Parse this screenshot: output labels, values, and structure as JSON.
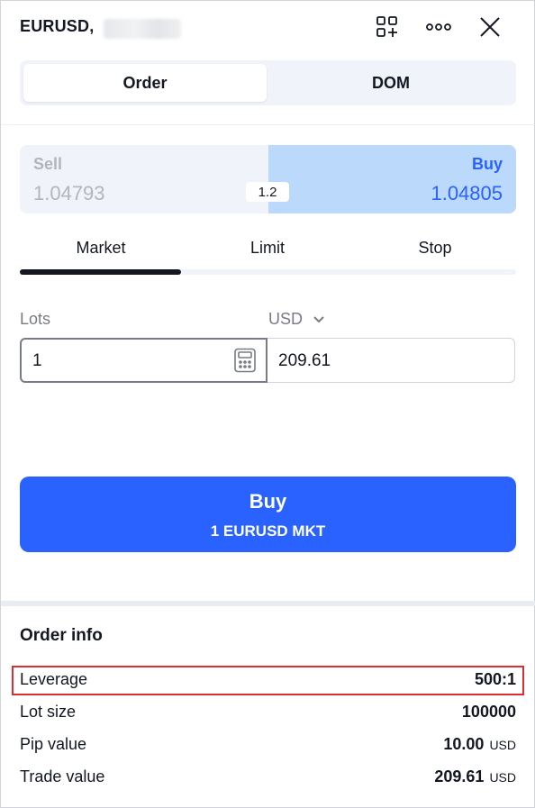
{
  "header": {
    "symbol": "EURUSD,",
    "icons": [
      "add-widget-icon",
      "more-icon",
      "close-icon"
    ]
  },
  "mode_tabs": [
    {
      "label": "Order",
      "active": true
    },
    {
      "label": "DOM",
      "active": false
    }
  ],
  "quote": {
    "sell_label": "Sell",
    "sell_price": "1.04793",
    "buy_label": "Buy",
    "buy_price": "1.04805",
    "spread": "1.2"
  },
  "order_types": [
    {
      "label": "Market",
      "active": true
    },
    {
      "label": "Limit",
      "active": false
    },
    {
      "label": "Stop",
      "active": false
    }
  ],
  "inputs": {
    "lots_label": "Lots",
    "lots_value": "1",
    "currency_label": "USD",
    "currency_value": "209.61"
  },
  "action": {
    "title": "Buy",
    "subtitle": "1 EURUSD MKT"
  },
  "order_info": {
    "title": "Order info",
    "rows": [
      {
        "key": "Leverage",
        "value": "500:1",
        "unit": ""
      },
      {
        "key": "Lot size",
        "value": "100000",
        "unit": ""
      },
      {
        "key": "Pip value",
        "value": "10.00",
        "unit": "USD"
      },
      {
        "key": "Trade value",
        "value": "209.61",
        "unit": "USD"
      }
    ]
  },
  "colors": {
    "accent": "#2962ff",
    "buy_bg": "#bbd9fb",
    "highlight_border": "#d9302f"
  }
}
